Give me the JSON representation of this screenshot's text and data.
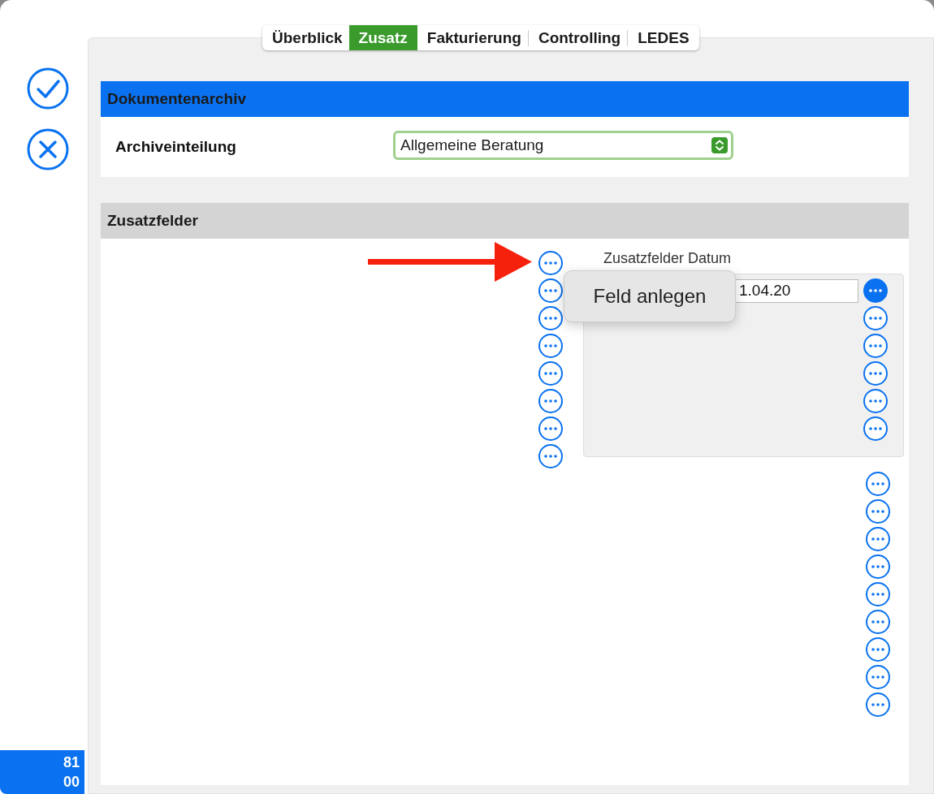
{
  "tabs": [
    {
      "label": "Überblick",
      "selected": false
    },
    {
      "label": "Zusatz",
      "selected": true
    },
    {
      "label": "Fakturierung",
      "selected": false
    },
    {
      "label": "Controlling",
      "selected": false
    },
    {
      "label": "LEDES",
      "selected": false
    }
  ],
  "archive_section": {
    "title": "Dokumentenarchiv",
    "field_label": "Archiveinteilung",
    "select_value": "Allgemeine Beratung"
  },
  "extra_section": {
    "title": "Zusatzfelder",
    "group_label": "Zusatzfelder Datum",
    "date_value": "1.04.20",
    "left_buttons": [
      {
        "active": false
      },
      {
        "active": false
      },
      {
        "active": false
      },
      {
        "active": false
      },
      {
        "active": false
      },
      {
        "active": false
      },
      {
        "active": false
      },
      {
        "active": false
      }
    ],
    "box_buttons": [
      {
        "active": true
      },
      {
        "active": false
      },
      {
        "active": false
      },
      {
        "active": false
      },
      {
        "active": false
      },
      {
        "active": false
      }
    ],
    "lower_buttons": [
      {
        "active": false
      },
      {
        "active": false
      },
      {
        "active": false
      },
      {
        "active": false
      },
      {
        "active": false
      },
      {
        "active": false
      },
      {
        "active": false
      },
      {
        "active": false
      },
      {
        "active": false
      }
    ]
  },
  "popover": {
    "label": "Feld anlegen"
  },
  "badge_lines": [
    "81",
    "00"
  ]
}
